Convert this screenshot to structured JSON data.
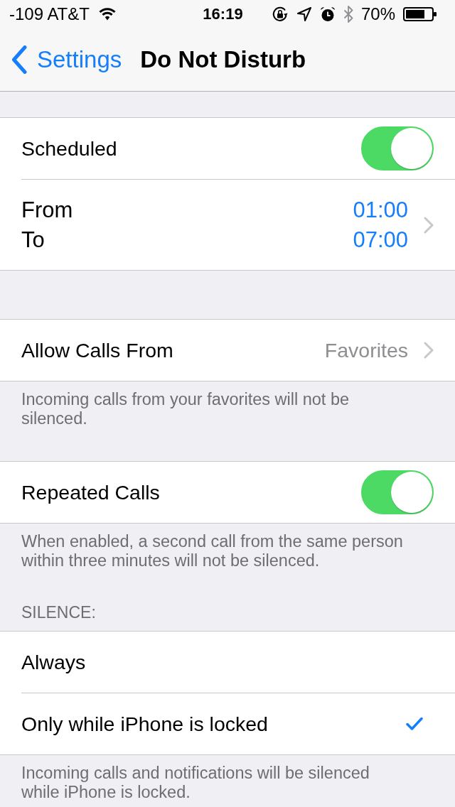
{
  "status_bar": {
    "carrier": "-109 AT&T",
    "time": "16:19",
    "battery": "70%"
  },
  "nav_bar": {
    "back": "Settings",
    "title": "Do Not Disturb"
  },
  "groups": [
    {
      "rows": [
        {
          "kind": "toggle",
          "label": "Scheduled",
          "on": true
        },
        {
          "kind": "time_range",
          "lines": [
            {
              "label": "From",
              "value": "01:00"
            },
            {
              "label": "To",
              "value": "07:00"
            }
          ]
        }
      ]
    },
    {
      "rows": [
        {
          "kind": "disclosure",
          "label": "Allow Calls From",
          "value": "Favorites"
        }
      ],
      "footer": "Incoming calls from your favorites will not be silenced."
    },
    {
      "rows": [
        {
          "kind": "toggle",
          "label": "Repeated Calls",
          "on": true
        }
      ],
      "footer": "When enabled, a second call from the same person within three minutes will not be silenced."
    },
    {
      "header": "SILENCE:",
      "rows": [
        {
          "kind": "option",
          "label": "Always",
          "selected": false
        },
        {
          "kind": "option",
          "label": "Only while iPhone is locked",
          "selected": true
        }
      ],
      "footer": "Incoming calls and notifications will be silenced while iPhone is locked."
    }
  ]
}
